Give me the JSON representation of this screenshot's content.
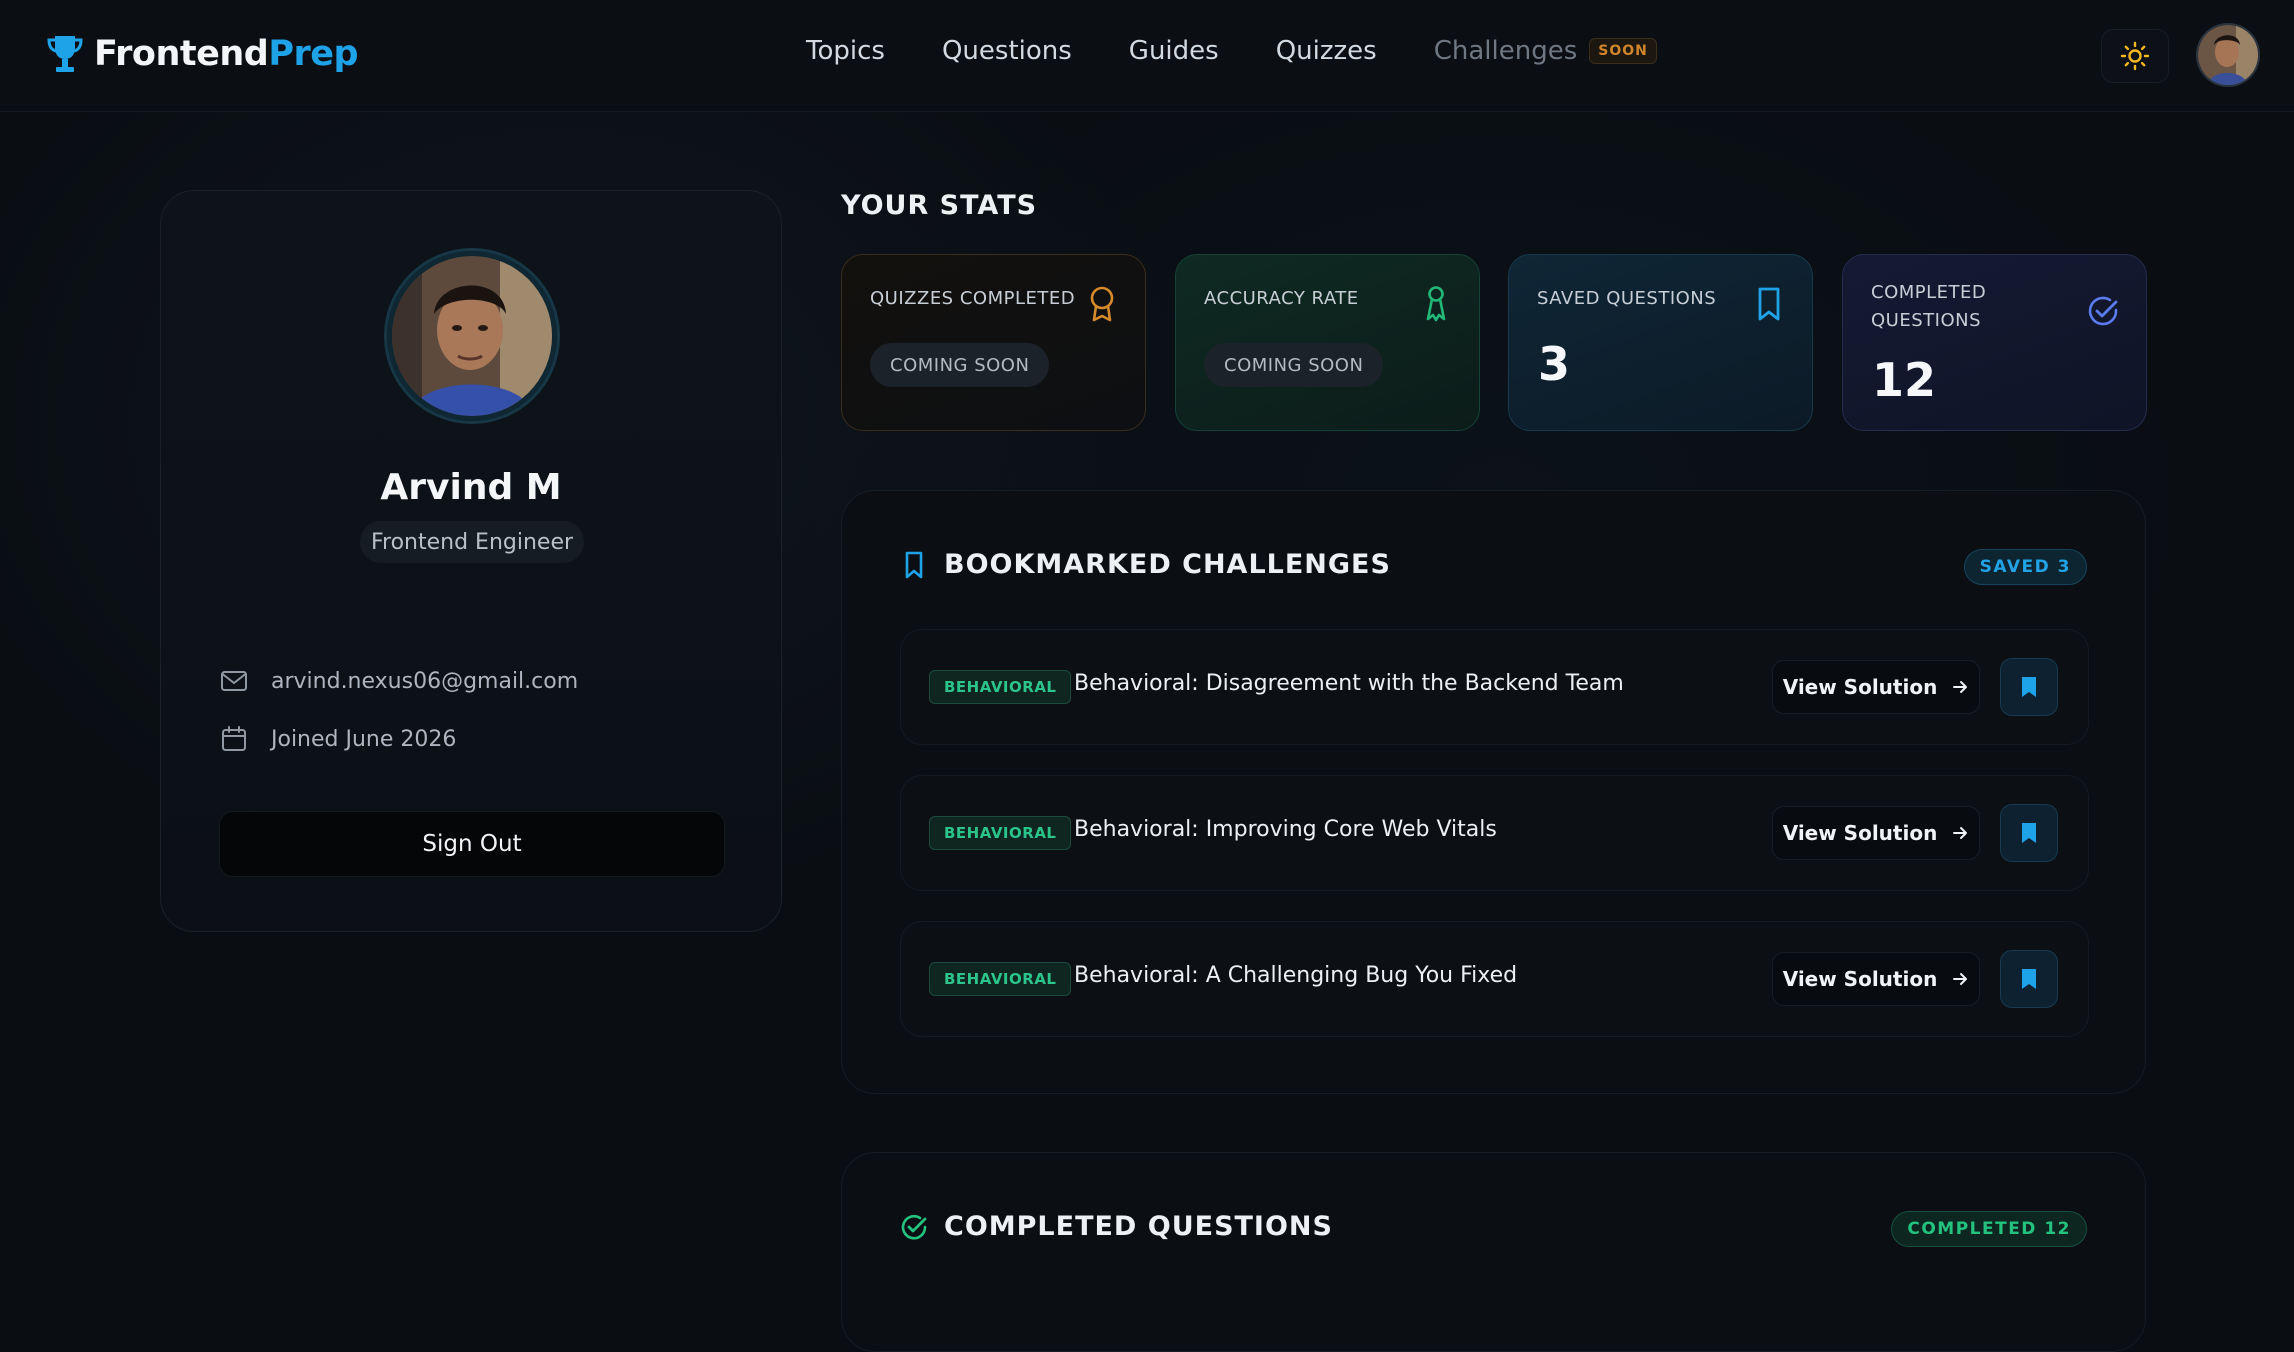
{
  "brand": {
    "part1": "Frontend",
    "part2": "Prep"
  },
  "nav": {
    "items": [
      "Topics",
      "Questions",
      "Guides",
      "Quizzes"
    ],
    "challenges_label": "Challenges",
    "challenges_badge": "SOON"
  },
  "profile": {
    "name": "Arvind M",
    "role": "Frontend Engineer",
    "email": "arvind.nexus06@gmail.com",
    "joined": "Joined June 2026",
    "signout_label": "Sign Out"
  },
  "stats": {
    "title": "YOUR STATS",
    "quizzes_completed": {
      "label": "QUIZZES COMPLETED",
      "value": "COMING SOON"
    },
    "accuracy_rate": {
      "label": "ACCURACY RATE",
      "value": "COMING SOON"
    },
    "saved_questions": {
      "label": "SAVED QUESTIONS",
      "value": "3"
    },
    "completed_questions": {
      "label_line1": "COMPLETED",
      "label_line2": "QUESTIONS",
      "value": "12"
    }
  },
  "bookmarked": {
    "title": "BOOKMARKED CHALLENGES",
    "badge": "SAVED 3",
    "items": [
      {
        "tag": "BEHAVIORAL",
        "title": "Behavioral: Disagreement with the Backend Team",
        "action": "View Solution"
      },
      {
        "tag": "BEHAVIORAL",
        "title": "Behavioral: Improving Core Web Vitals",
        "action": "View Solution"
      },
      {
        "tag": "BEHAVIORAL",
        "title": "Behavioral: A Challenging Bug You Fixed",
        "action": "View Solution"
      }
    ]
  },
  "completed": {
    "title": "COMPLETED QUESTIONS",
    "badge": "COMPLETED 12"
  },
  "colors": {
    "accent_blue": "#1fa3e8",
    "accent_green": "#24c27f",
    "accent_orange": "#d1852b",
    "accent_indigo": "#5b7cf0"
  },
  "icons": [
    "trophy-icon",
    "sun-icon",
    "medal-icon",
    "ribbon-icon",
    "bookmark-icon",
    "check-circle-icon",
    "mail-icon",
    "calendar-icon",
    "arrow-right-icon"
  ]
}
